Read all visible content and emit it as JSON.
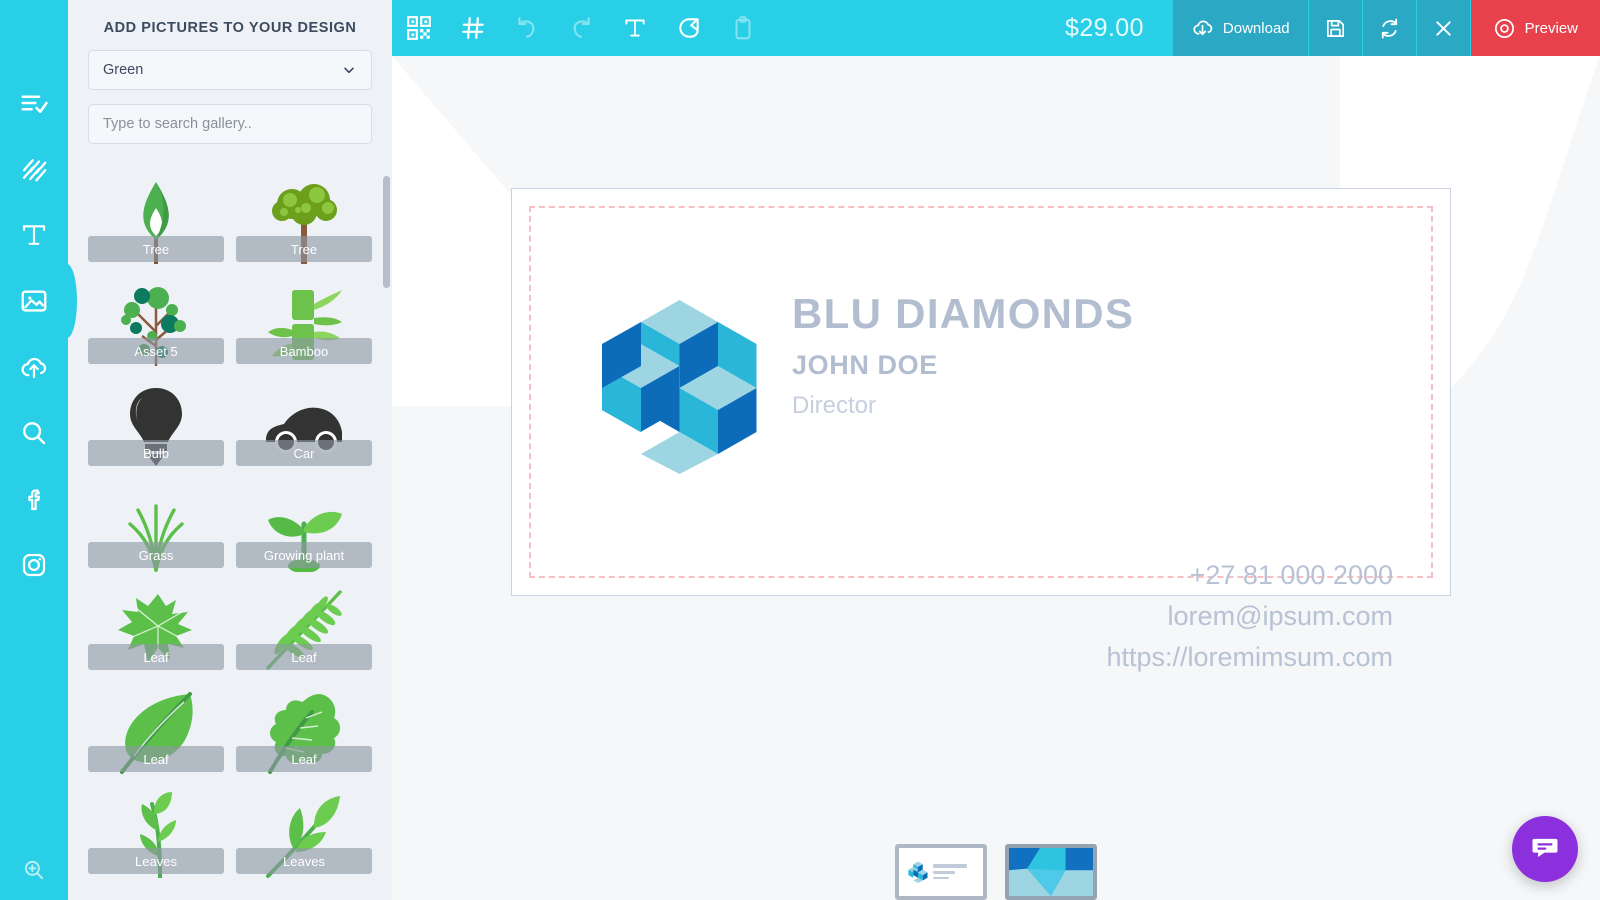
{
  "rail": {
    "items": [
      {
        "icon": "list-check-icon",
        "name": "templates"
      },
      {
        "icon": "pattern-icon",
        "name": "backgrounds"
      },
      {
        "icon": "text-icon",
        "name": "text"
      },
      {
        "icon": "image-icon",
        "name": "pictures"
      },
      {
        "icon": "upload-cloud-icon",
        "name": "uploads"
      },
      {
        "icon": "search-icon",
        "name": "search"
      },
      {
        "icon": "facebook-icon",
        "name": "facebook"
      },
      {
        "icon": "instagram-icon",
        "name": "instagram"
      }
    ],
    "active_index": 3,
    "bottom_icon": "zoom-in-icon"
  },
  "panel": {
    "title": "ADD PICTURES TO YOUR DESIGN",
    "category": {
      "value": "Green",
      "icon": "chevron-down-icon"
    },
    "search": {
      "value": "",
      "placeholder": "Type to search gallery.."
    },
    "gallery": [
      {
        "label": "Tree",
        "art": "tree-pointed"
      },
      {
        "label": "Tree",
        "art": "tree-bushy"
      },
      {
        "label": "Asset 5",
        "art": "tree-dots"
      },
      {
        "label": "Bamboo",
        "art": "bamboo"
      },
      {
        "label": "Bulb",
        "art": "bulb"
      },
      {
        "label": "Car",
        "art": "car"
      },
      {
        "label": "Grass",
        "art": "grass"
      },
      {
        "label": "Growing plant",
        "art": "sprout"
      },
      {
        "label": "Leaf",
        "art": "leaf-maple"
      },
      {
        "label": "Leaf",
        "art": "leaf-fern"
      },
      {
        "label": "Leaf",
        "art": "leaf-simple"
      },
      {
        "label": "Leaf",
        "art": "leaf-oak"
      },
      {
        "label": "Leaves",
        "art": "leaves-a"
      },
      {
        "label": "Leaves",
        "art": "leaves-b"
      }
    ]
  },
  "toolbar": {
    "tools": [
      {
        "icon": "qr-code-icon",
        "name": "qr-code",
        "disabled": false
      },
      {
        "icon": "grid-icon",
        "name": "grid",
        "disabled": false
      },
      {
        "icon": "undo-icon",
        "name": "undo",
        "disabled": true
      },
      {
        "icon": "redo-icon",
        "name": "redo",
        "disabled": true
      },
      {
        "icon": "text-icon",
        "name": "add-text",
        "disabled": false
      },
      {
        "icon": "duplicate-icon",
        "name": "duplicate",
        "disabled": false
      },
      {
        "icon": "clipboard-icon",
        "name": "paste",
        "disabled": true
      }
    ],
    "price": "$29.00",
    "download_label": "Download",
    "download_icon": "download-cloud-icon",
    "save_icon": "floppy-save-icon",
    "reset_icon": "refresh-icon",
    "close_icon": "close-x-icon",
    "preview_label": "Preview",
    "preview_icon": "eye-icon"
  },
  "card": {
    "title": "BLU DIAMONDS",
    "name": "JOHN DOE",
    "role": "Director",
    "phone": "+27 81 000 2000",
    "email": "lorem@ipsum.com",
    "website": "https://loremimsum.com",
    "logo_name": "isometric-cubes-logo"
  },
  "pages": [
    {
      "name": "page-front",
      "selected": false
    },
    {
      "name": "page-back",
      "selected": true
    }
  ],
  "chat": {
    "icon": "chat-bubble-icon"
  },
  "colors": {
    "brand_cyan": "#29cfe6",
    "toolbar_button": "#2aa8c4",
    "preview_red": "#e8414c",
    "panel_bg": "#eef2f7",
    "card_text": "#b2bdd0",
    "logo_dark_blue": "#0d6cb9",
    "logo_cyan": "#29b6d8",
    "logo_light_blue": "#9dd5e3",
    "bleed_guide": "#f7bfc3",
    "chat_purple": "#8c30dd"
  }
}
